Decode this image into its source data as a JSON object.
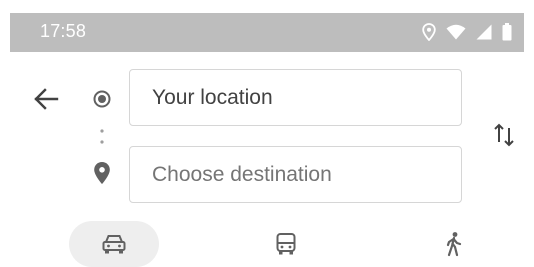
{
  "status_bar": {
    "time": "17:58",
    "icons": [
      "location-icon",
      "wifi-icon",
      "signal-icon",
      "battery-icon"
    ]
  },
  "directions": {
    "back_icon": "arrow-left-icon",
    "origin": {
      "value": "Your location",
      "icon": "origin-dot-icon"
    },
    "destination": {
      "placeholder": "Choose destination",
      "icon": "destination-pin-icon"
    },
    "swap_icon": "swap-vertical-icon"
  },
  "travel_modes": [
    {
      "mode": "drive",
      "icon": "car-icon",
      "selected": true
    },
    {
      "mode": "transit",
      "icon": "bus-icon",
      "selected": false
    },
    {
      "mode": "walk",
      "icon": "walk-icon",
      "selected": false
    }
  ],
  "colors": {
    "status_bar_bg": "#bdbdbd",
    "selected_mode_bg": "#eeeeee",
    "icon_gray": "#616161",
    "field_border": "#d6d6d6"
  }
}
